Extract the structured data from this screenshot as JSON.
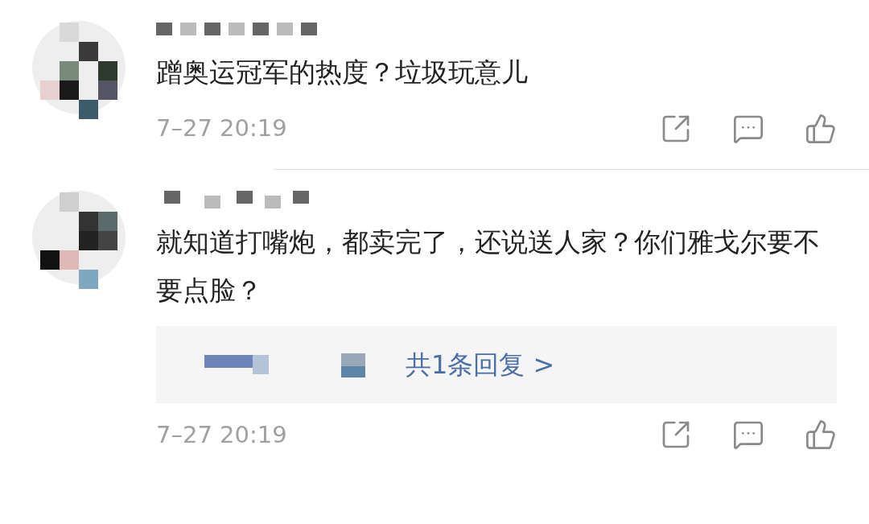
{
  "comments": [
    {
      "text": "蹭奥运冠军的热度？垃圾玩意儿",
      "time": "7–27 20:19"
    },
    {
      "text": "就知道打嘴炮，都卖完了，还说送人家？你们雅戈尔要不要点脸？",
      "time": "7–27 20:19",
      "reply_link": "共1条回复 >"
    }
  ]
}
